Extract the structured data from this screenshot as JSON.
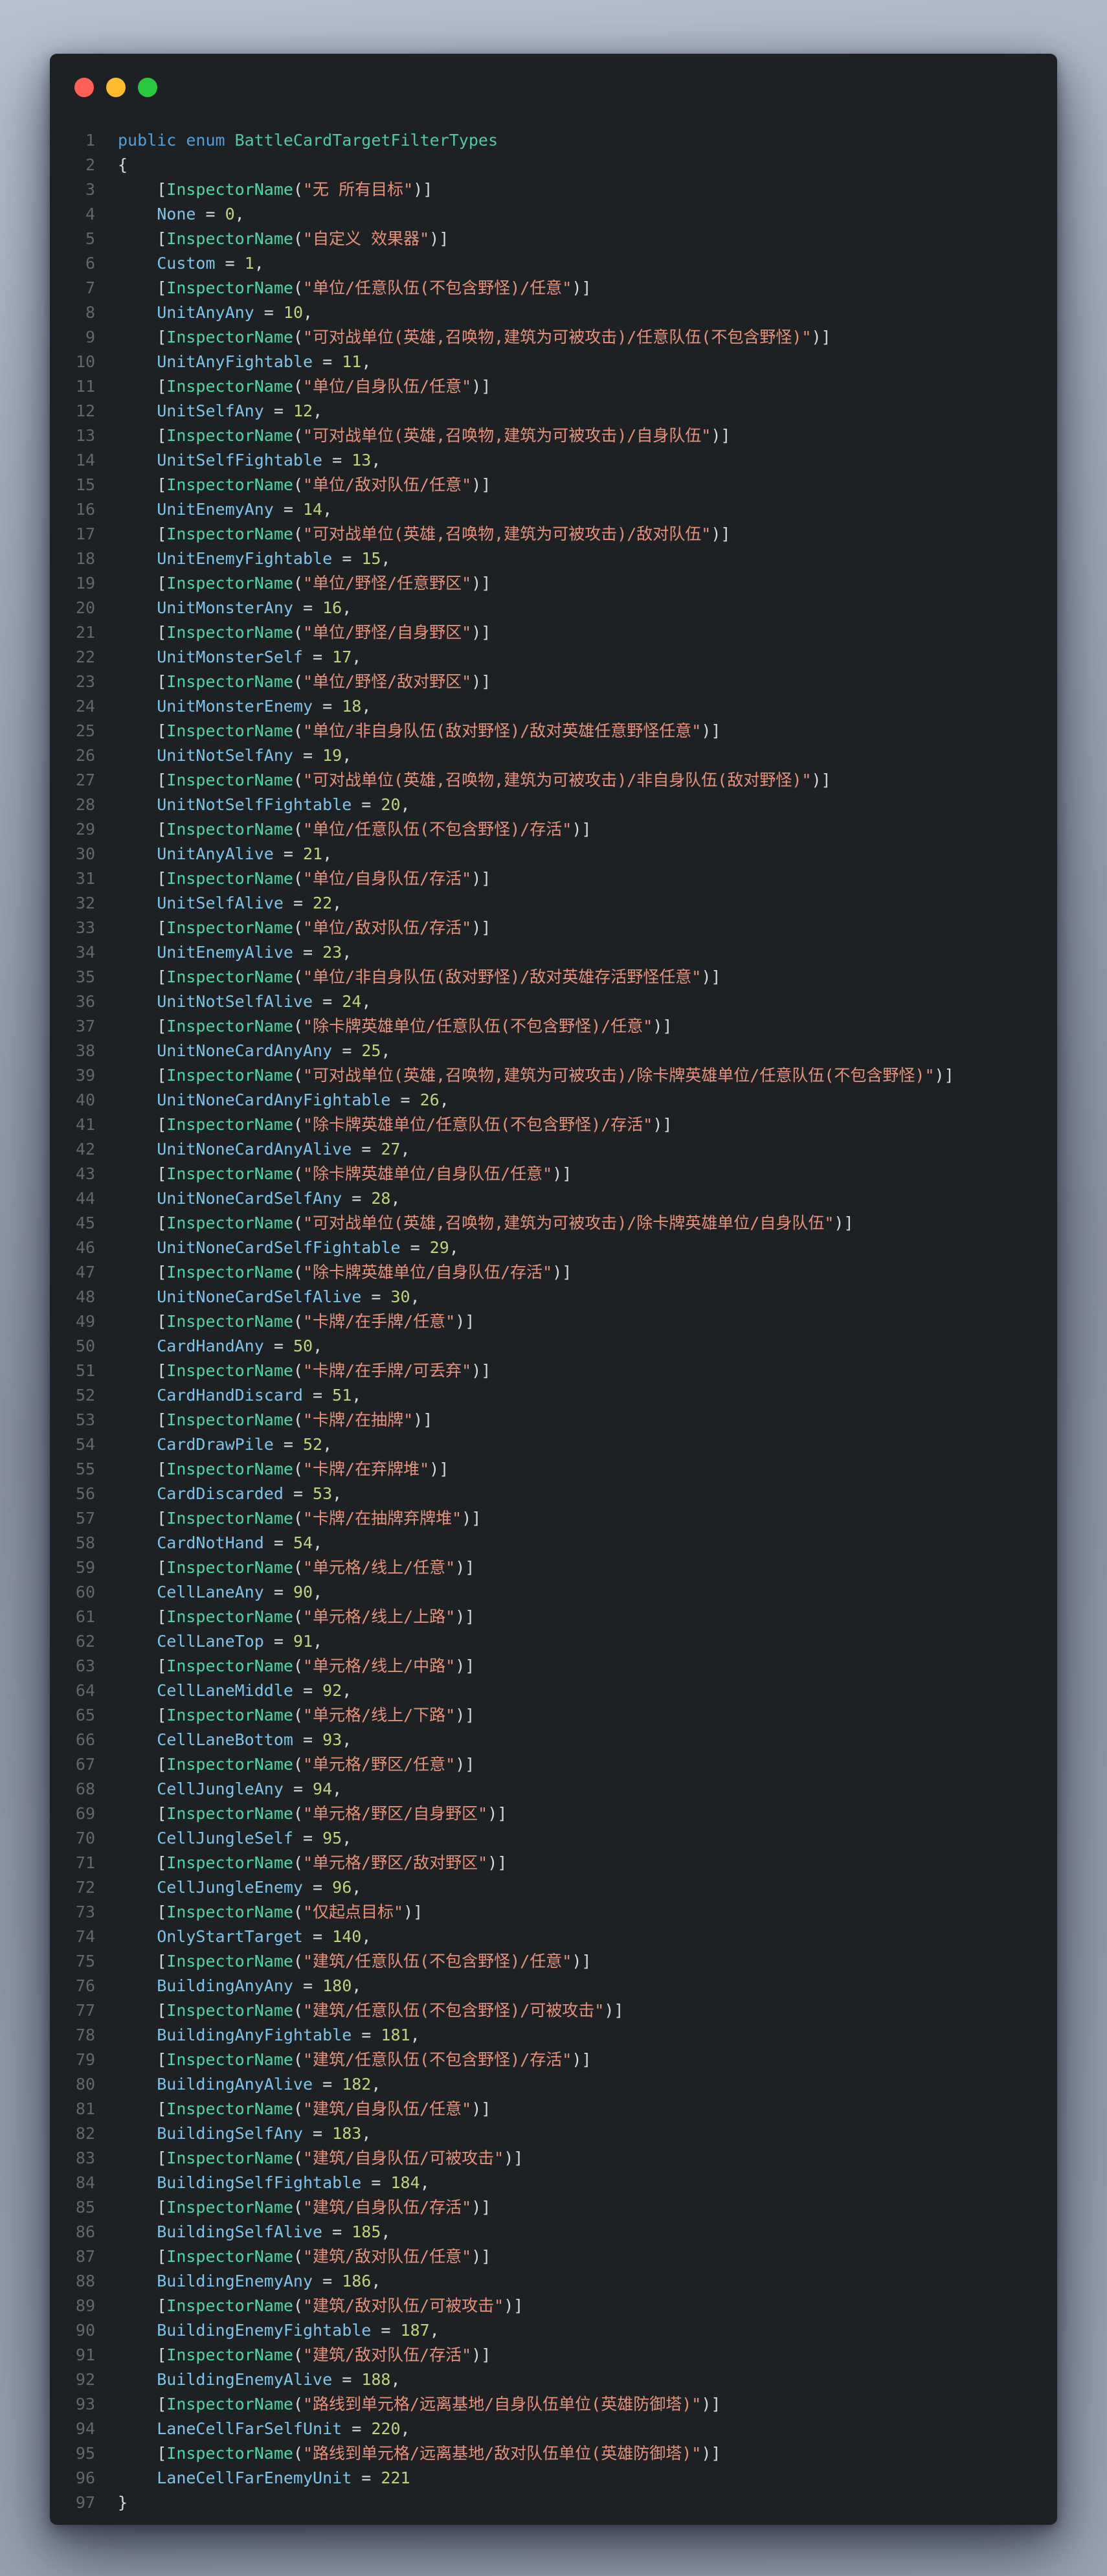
{
  "window": {
    "traffic_lights": {
      "close": "#fe5f57",
      "minimize": "#febc2e",
      "maximize": "#2ac840"
    },
    "background": "#1e2124"
  },
  "colors": {
    "syntax": {
      "window-bg": "#1e2124",
      "keyword": "#4f9fdc",
      "type": "#4fc9a2",
      "attr": "#50d6a4",
      "str": "#e5917b",
      "name": "#7ec3e8",
      "num": "#bfd27e",
      "punc": "#d6d8da",
      "line-number": "#63676a"
    }
  },
  "code": {
    "keyword": "public enum",
    "enum_name": "BattleCardTargetFilterTypes",
    "attribute_name": "InspectorName",
    "open_brace": "{",
    "close_brace": "}",
    "total_lines": 97,
    "entries": [
      {
        "label": "无 所有目标",
        "name": "None",
        "value": "0"
      },
      {
        "label": "自定义 效果器",
        "name": "Custom",
        "value": "1"
      },
      {
        "label": "单位/任意队伍(不包含野怪)/任意",
        "name": "UnitAnyAny",
        "value": "10"
      },
      {
        "label": "可对战单位(英雄,召唤物,建筑为可被攻击)/任意队伍(不包含野怪)",
        "name": "UnitAnyFightable",
        "value": "11"
      },
      {
        "label": "单位/自身队伍/任意",
        "name": "UnitSelfAny",
        "value": "12"
      },
      {
        "label": "可对战单位(英雄,召唤物,建筑为可被攻击)/自身队伍",
        "name": "UnitSelfFightable",
        "value": "13"
      },
      {
        "label": "单位/敌对队伍/任意",
        "name": "UnitEnemyAny",
        "value": "14"
      },
      {
        "label": "可对战单位(英雄,召唤物,建筑为可被攻击)/敌对队伍",
        "name": "UnitEnemyFightable",
        "value": "15"
      },
      {
        "label": "单位/野怪/任意野区",
        "name": "UnitMonsterAny",
        "value": "16"
      },
      {
        "label": "单位/野怪/自身野区",
        "name": "UnitMonsterSelf",
        "value": "17"
      },
      {
        "label": "单位/野怪/敌对野区",
        "name": "UnitMonsterEnemy",
        "value": "18"
      },
      {
        "label": "单位/非自身队伍(敌对野怪)/敌对英雄任意野怪任意",
        "name": "UnitNotSelfAny",
        "value": "19"
      },
      {
        "label": "可对战单位(英雄,召唤物,建筑为可被攻击)/非自身队伍(敌对野怪)",
        "name": "UnitNotSelfFightable",
        "value": "20"
      },
      {
        "label": "单位/任意队伍(不包含野怪)/存活",
        "name": "UnitAnyAlive",
        "value": "21"
      },
      {
        "label": "单位/自身队伍/存活",
        "name": "UnitSelfAlive",
        "value": "22"
      },
      {
        "label": "单位/敌对队伍/存活",
        "name": "UnitEnemyAlive",
        "value": "23"
      },
      {
        "label": "单位/非自身队伍(敌对野怪)/敌对英雄存活野怪任意",
        "name": "UnitNotSelfAlive",
        "value": "24"
      },
      {
        "label": "除卡牌英雄单位/任意队伍(不包含野怪)/任意",
        "name": "UnitNoneCardAnyAny",
        "value": "25"
      },
      {
        "label": "可对战单位(英雄,召唤物,建筑为可被攻击)/除卡牌英雄单位/任意队伍(不包含野怪)",
        "name": "UnitNoneCardAnyFightable",
        "value": "26"
      },
      {
        "label": "除卡牌英雄单位/任意队伍(不包含野怪)/存活",
        "name": "UnitNoneCardAnyAlive",
        "value": "27"
      },
      {
        "label": "除卡牌英雄单位/自身队伍/任意",
        "name": "UnitNoneCardSelfAny",
        "value": "28"
      },
      {
        "label": "可对战单位(英雄,召唤物,建筑为可被攻击)/除卡牌英雄单位/自身队伍",
        "name": "UnitNoneCardSelfFightable",
        "value": "29"
      },
      {
        "label": "除卡牌英雄单位/自身队伍/存活",
        "name": "UnitNoneCardSelfAlive",
        "value": "30"
      },
      {
        "label": "卡牌/在手牌/任意",
        "name": "CardHandAny",
        "value": "50"
      },
      {
        "label": "卡牌/在手牌/可丢弃",
        "name": "CardHandDiscard",
        "value": "51"
      },
      {
        "label": "卡牌/在抽牌",
        "name": "CardDrawPile",
        "value": "52"
      },
      {
        "label": "卡牌/在弃牌堆",
        "name": "CardDiscarded",
        "value": "53"
      },
      {
        "label": "卡牌/在抽牌弃牌堆",
        "name": "CardNotHand",
        "value": "54"
      },
      {
        "label": "单元格/线上/任意",
        "name": "CellLaneAny",
        "value": "90"
      },
      {
        "label": "单元格/线上/上路",
        "name": "CellLaneTop",
        "value": "91"
      },
      {
        "label": "单元格/线上/中路",
        "name": "CellLaneMiddle",
        "value": "92"
      },
      {
        "label": "单元格/线上/下路",
        "name": "CellLaneBottom",
        "value": "93"
      },
      {
        "label": "单元格/野区/任意",
        "name": "CellJungleAny",
        "value": "94"
      },
      {
        "label": "单元格/野区/自身野区",
        "name": "CellJungleSelf",
        "value": "95"
      },
      {
        "label": "单元格/野区/敌对野区",
        "name": "CellJungleEnemy",
        "value": "96"
      },
      {
        "label": "仅起点目标",
        "name": "OnlyStartTarget",
        "value": "140"
      },
      {
        "label": "建筑/任意队伍(不包含野怪)/任意",
        "name": "BuildingAnyAny",
        "value": "180"
      },
      {
        "label": "建筑/任意队伍(不包含野怪)/可被攻击",
        "name": "BuildingAnyFightable",
        "value": "181"
      },
      {
        "label": "建筑/任意队伍(不包含野怪)/存活",
        "name": "BuildingAnyAlive",
        "value": "182"
      },
      {
        "label": "建筑/自身队伍/任意",
        "name": "BuildingSelfAny",
        "value": "183"
      },
      {
        "label": "建筑/自身队伍/可被攻击",
        "name": "BuildingSelfFightable",
        "value": "184"
      },
      {
        "label": "建筑/自身队伍/存活",
        "name": "BuildingSelfAlive",
        "value": "185"
      },
      {
        "label": "建筑/敌对队伍/任意",
        "name": "BuildingEnemyAny",
        "value": "186"
      },
      {
        "label": "建筑/敌对队伍/可被攻击",
        "name": "BuildingEnemyFightable",
        "value": "187"
      },
      {
        "label": "建筑/敌对队伍/存活",
        "name": "BuildingEnemyAlive",
        "value": "188"
      },
      {
        "label": "路线到单元格/远离基地/自身队伍单位(英雄防御塔)",
        "name": "LaneCellFarSelfUnit",
        "value": "220"
      },
      {
        "label": "路线到单元格/远离基地/敌对队伍单位(英雄防御塔)",
        "name": "LaneCellFarEnemyUnit",
        "value": "221"
      }
    ]
  }
}
